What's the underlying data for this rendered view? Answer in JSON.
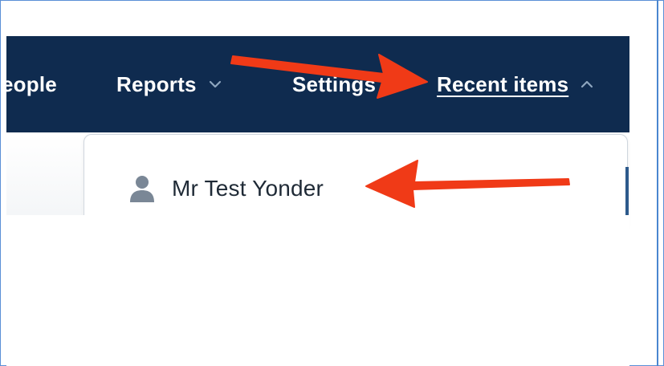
{
  "navigation": {
    "items": [
      {
        "label": "eople"
      },
      {
        "label": "Reports",
        "icon": "chevron-down-icon"
      },
      {
        "label": "Settings"
      },
      {
        "label": "Recent items",
        "icon": "chevron-up-icon"
      }
    ]
  },
  "recent_items_menu": {
    "items": [
      {
        "label": "Mr Test Yonder",
        "icon": "person-icon"
      }
    ]
  },
  "colors": {
    "navbar_background": "#0f2b4f",
    "annotation_arrow": "#f03a17",
    "frame_border": "#5b8fd6"
  }
}
